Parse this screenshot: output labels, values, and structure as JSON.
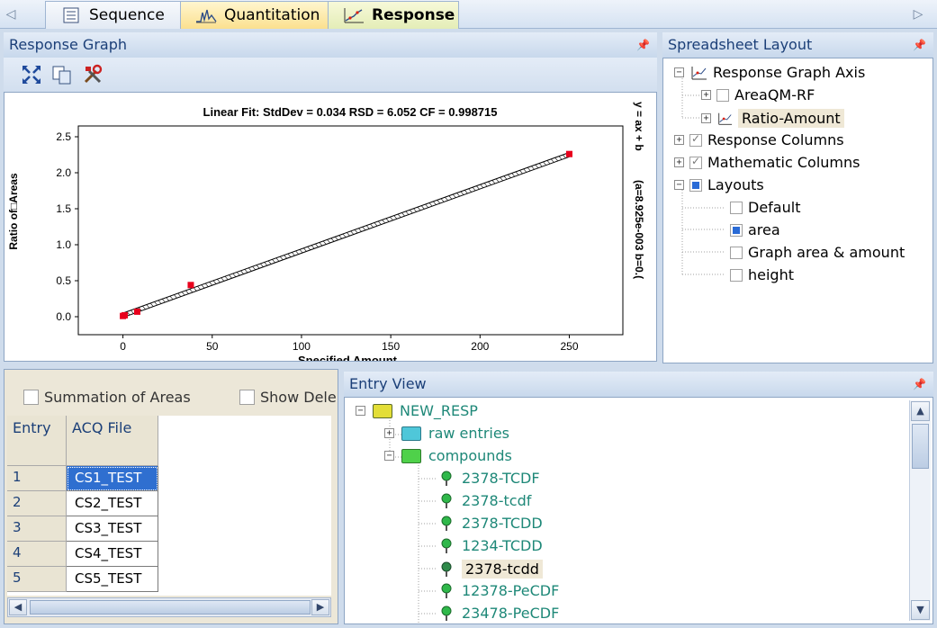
{
  "tabs": [
    {
      "label": "Sequence"
    },
    {
      "label": "Quantitation"
    },
    {
      "label": "Response"
    }
  ],
  "response_graph": {
    "title": "Response Graph"
  },
  "chart_data": {
    "type": "scatter",
    "title": "Linear Fit: StdDev = 0.034 RSD = 6.052 CF = 0.998715",
    "xlabel": "Specified Amount",
    "ylabel": "Ratio of□Areas",
    "xlim": [
      -25,
      280
    ],
    "ylim": [
      -0.25,
      2.65
    ],
    "xticks": [
      "0",
      "50",
      "100",
      "150",
      "200",
      "250"
    ],
    "yticks": [
      "0.0",
      "0.5",
      "1.0",
      "1.5",
      "2.0",
      "2.5"
    ],
    "right_label_1": "y = ax + b",
    "right_label_2": "(a=8.925e-003  b=0.(",
    "points": [
      {
        "x": 0,
        "y": 0.01
      },
      {
        "x": 1,
        "y": 0.02
      },
      {
        "x": 8,
        "y": 0.07
      },
      {
        "x": 38,
        "y": 0.44
      },
      {
        "x": 250,
        "y": 2.26
      }
    ],
    "fit": {
      "a": 0.008925,
      "b": 0.02
    },
    "point_color": "#e8001c",
    "line_color": "#000000"
  },
  "spreadsheet_layout": {
    "title": "Spreadsheet Layout",
    "items": [
      {
        "label": "Response Graph Axis"
      },
      {
        "label": "AreaQM-RF"
      },
      {
        "label": "Ratio-Amount"
      },
      {
        "label": "Response Columns"
      },
      {
        "label": "Mathematic Columns"
      },
      {
        "label": "Layouts"
      },
      {
        "label": "Default"
      },
      {
        "label": "area"
      },
      {
        "label": "Graph area & amount"
      },
      {
        "label": "height"
      }
    ]
  },
  "table": {
    "summation_label": "Summation of Areas",
    "show_deleted_label": "Show Dele",
    "headers": [
      "Entry",
      "ACQ File"
    ],
    "rows": [
      {
        "entry": "1",
        "file": "CS1_TEST"
      },
      {
        "entry": "2",
        "file": "CS2_TEST"
      },
      {
        "entry": "3",
        "file": "CS3_TEST"
      },
      {
        "entry": "4",
        "file": "CS4_TEST"
      },
      {
        "entry": "5",
        "file": "CS5_TEST"
      }
    ]
  },
  "entry_view": {
    "title": "Entry View",
    "root": "NEW_RESP",
    "folders": [
      "raw entries",
      "compounds"
    ],
    "compounds": [
      "2378-TCDF",
      "2378-tcdf",
      "2378-TCDD",
      "1234-TCDD",
      "2378-tcdd",
      "12378-PeCDF",
      "23478-PeCDF"
    ]
  },
  "colors": {
    "selection": "#2f6fd0",
    "teal_text": "#1e8878",
    "title_text": "#1b3f78"
  }
}
